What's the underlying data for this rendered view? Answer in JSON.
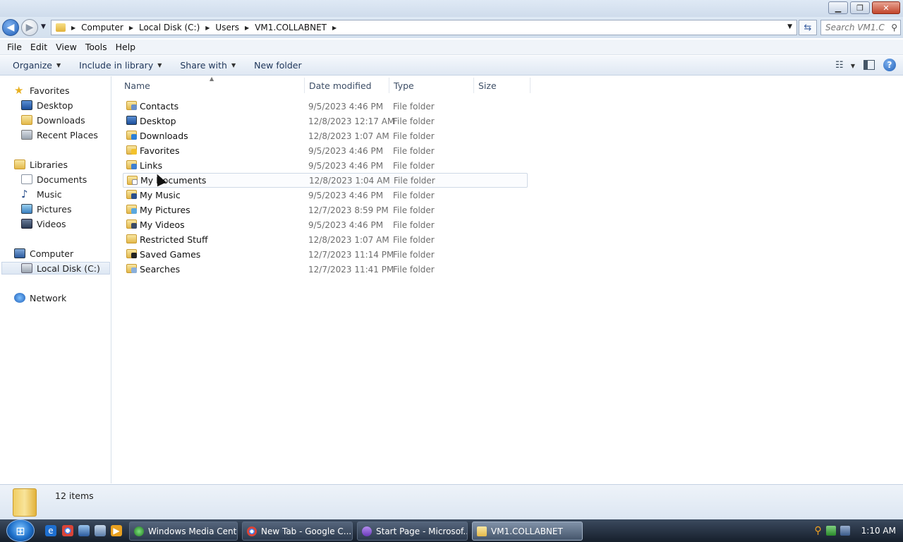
{
  "address": {
    "crumbs": [
      "Computer",
      "Local Disk (C:)",
      "Users",
      "VM1.COLLABNET"
    ],
    "search_placeholder": "Search VM1.C..."
  },
  "menu": [
    "File",
    "Edit",
    "View",
    "Tools",
    "Help"
  ],
  "commands": {
    "organize": "Organize",
    "include": "Include in library",
    "share": "Share with",
    "new_folder": "New folder"
  },
  "nav": {
    "favorites": "Favorites",
    "desktop": "Desktop",
    "downloads": "Downloads",
    "recent": "Recent Places",
    "libraries": "Libraries",
    "documents": "Documents",
    "music": "Music",
    "pictures": "Pictures",
    "videos": "Videos",
    "computer": "Computer",
    "localdisk": "Local Disk (C:)",
    "network": "Network"
  },
  "columns": {
    "name": "Name",
    "date": "Date modified",
    "type": "Type",
    "size": "Size"
  },
  "files": [
    {
      "name": "Contacts",
      "date": "9/5/2023 4:46 PM",
      "type": "File folder"
    },
    {
      "name": "Desktop",
      "date": "12/8/2023 12:17 AM",
      "type": "File folder"
    },
    {
      "name": "Downloads",
      "date": "12/8/2023 1:07 AM",
      "type": "File folder"
    },
    {
      "name": "Favorites",
      "date": "9/5/2023 4:46 PM",
      "type": "File folder"
    },
    {
      "name": "Links",
      "date": "9/5/2023 4:46 PM",
      "type": "File folder"
    },
    {
      "name": "My Documents",
      "date": "12/8/2023 1:04 AM",
      "type": "File folder"
    },
    {
      "name": "My Music",
      "date": "9/5/2023 4:46 PM",
      "type": "File folder"
    },
    {
      "name": "My Pictures",
      "date": "12/7/2023 8:59 PM",
      "type": "File folder"
    },
    {
      "name": "My Videos",
      "date": "9/5/2023 4:46 PM",
      "type": "File folder"
    },
    {
      "name": "Restricted Stuff",
      "date": "12/8/2023 1:07 AM",
      "type": "File folder"
    },
    {
      "name": "Saved Games",
      "date": "12/7/2023 11:14 PM",
      "type": "File folder"
    },
    {
      "name": "Searches",
      "date": "12/7/2023 11:41 PM",
      "type": "File folder"
    }
  ],
  "status": {
    "count": "12 items"
  },
  "taskbar": {
    "items": [
      "Windows Media Cent...",
      "New Tab - Google C...",
      "Start Page - Microsof...",
      "VM1.COLLABNET"
    ],
    "clock": "1:10 AM"
  },
  "colors": {
    "accent": "#1f5fb8",
    "folder": "#e3b84a"
  }
}
